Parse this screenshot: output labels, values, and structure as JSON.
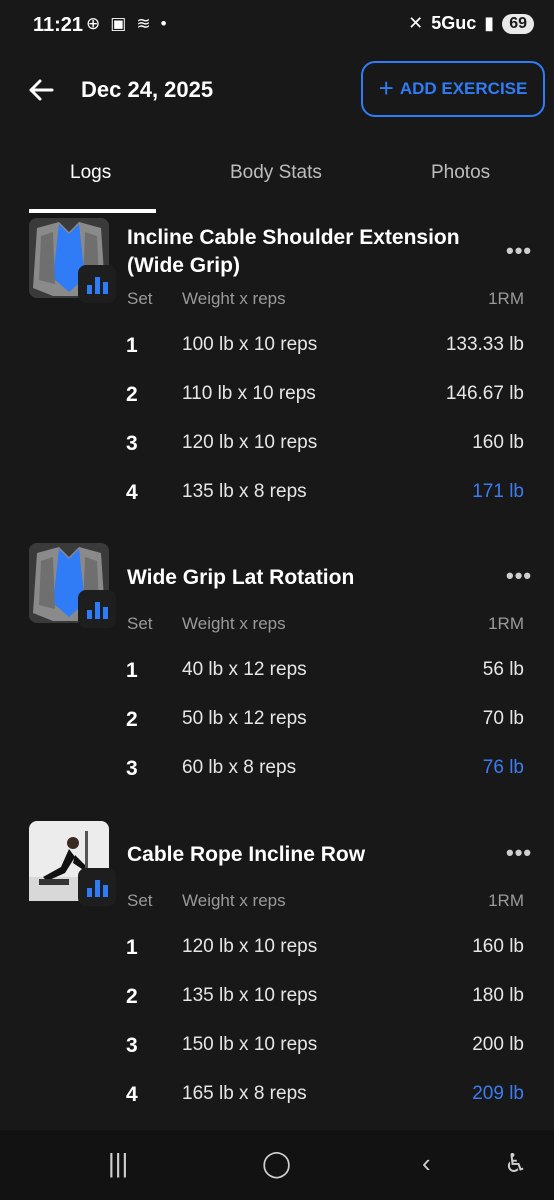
{
  "status_bar": {
    "time": "11:21",
    "network": "5Guc",
    "battery": "69"
  },
  "header": {
    "date": "Dec 24, 2025",
    "add_button": "ADD EXERCISE"
  },
  "tabs": [
    {
      "label": "Logs",
      "active": true
    },
    {
      "label": "Body Stats",
      "active": false
    },
    {
      "label": "Photos",
      "active": false
    }
  ],
  "columns": {
    "set": "Set",
    "weight_reps": "Weight x reps",
    "one_rm": "1RM"
  },
  "exercises": [
    {
      "name": "Incline Cable Shoulder Extension (Wide Grip)",
      "thumbnail": "muscle-anatomy",
      "sets": [
        {
          "set": "1",
          "weight_reps": "100 lb x 10 reps",
          "one_rm": "133.33 lb",
          "best": false
        },
        {
          "set": "2",
          "weight_reps": "110 lb x 10 reps",
          "one_rm": "146.67 lb",
          "best": false
        },
        {
          "set": "3",
          "weight_reps": "120 lb x 10 reps",
          "one_rm": "160 lb",
          "best": false
        },
        {
          "set": "4",
          "weight_reps": "135 lb x 8 reps",
          "one_rm": "171 lb",
          "best": true
        }
      ]
    },
    {
      "name": "Wide Grip Lat Rotation",
      "thumbnail": "muscle-anatomy",
      "sets": [
        {
          "set": "1",
          "weight_reps": "40 lb x 12 reps",
          "one_rm": "56 lb",
          "best": false
        },
        {
          "set": "2",
          "weight_reps": "50 lb x 12 reps",
          "one_rm": "70 lb",
          "best": false
        },
        {
          "set": "3",
          "weight_reps": "60 lb x 8 reps",
          "one_rm": "76 lb",
          "best": true
        }
      ]
    },
    {
      "name": "Cable Rope Incline Row",
      "thumbnail": "exercise-photo",
      "sets": [
        {
          "set": "1",
          "weight_reps": "120 lb x 10 reps",
          "one_rm": "160 lb",
          "best": false
        },
        {
          "set": "2",
          "weight_reps": "135 lb x 10 reps",
          "one_rm": "180 lb",
          "best": false
        },
        {
          "set": "3",
          "weight_reps": "150 lb x 10 reps",
          "one_rm": "200 lb",
          "best": false
        },
        {
          "set": "4",
          "weight_reps": "165 lb x 8 reps",
          "one_rm": "209 lb",
          "best": true
        }
      ]
    }
  ],
  "colors": {
    "accent": "#2f7cf6",
    "background": "#181818"
  }
}
